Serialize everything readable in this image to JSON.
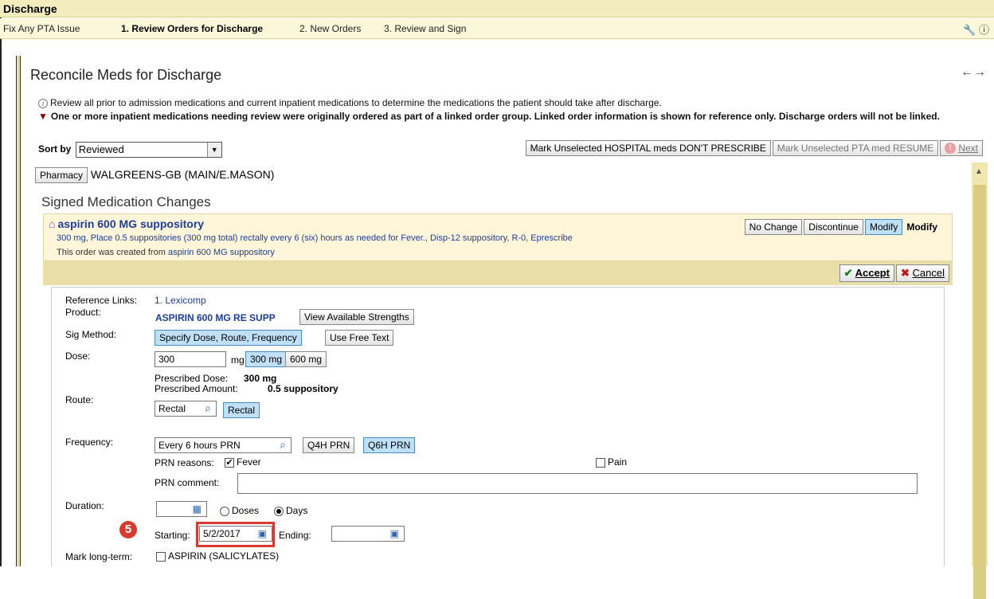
{
  "window": {
    "title": "Discharge"
  },
  "nav": {
    "items": [
      {
        "label": "Fix Any PTA Issue",
        "active": false
      },
      {
        "label": "1. Review Orders for Discharge",
        "active": true
      },
      {
        "label": "2. New Orders",
        "active": false
      },
      {
        "label": "3. Review and Sign",
        "active": false
      }
    ]
  },
  "section": {
    "title": "Reconcile Meds for Discharge"
  },
  "info": {
    "line1": "Review all prior to admission medications and current inpatient medications to determine the medications the patient should take after discharge.",
    "line2": "One or more inpatient medications needing review were originally ordered as part of a linked order group. Linked order information is shown for reference only. Discharge orders will not be linked."
  },
  "sort": {
    "label": "Sort by",
    "value": "Reviewed"
  },
  "actions": {
    "mark_hospital": "Mark Unselected HOSPITAL meds DON'T PRESCRIBE",
    "mark_pta": "Mark Unselected PTA med RESUME",
    "next": "Next"
  },
  "pharmacy": {
    "button": "Pharmacy",
    "name": "WALGREENS-GB (MAIN/E.MASON)"
  },
  "signed_changes": {
    "title": "Signed Medication Changes"
  },
  "med": {
    "name": "aspirin 600 MG suppository",
    "description": "300 mg, Place 0.5 suppositories (300 mg total) rectally every 6 (six) hours as needed for Fever., Disp-12 suppository, R-0, Eprescribe",
    "source_prefix": "This order was created from",
    "source_link": "aspirin 600 MG suppository",
    "buttons": {
      "no_change": "No Change",
      "discontinue": "Discontinue",
      "modify": "Modify"
    },
    "status": "Modify"
  },
  "edit": {
    "accept": "Accept",
    "cancel": "Cancel"
  },
  "order": {
    "ref_links_label": "Reference Links:",
    "ref_links_value": "1. Lexicomp",
    "product_label": "Product:",
    "product_value": "ASPIRIN 600 MG RE SUPP",
    "view_strengths": "View Available Strengths",
    "sig_label": "Sig Method:",
    "sig_specify": "Specify Dose, Route, Frequency",
    "sig_free": "Use Free Text",
    "dose_label": "Dose:",
    "dose_value": "300",
    "dose_unit": "mg",
    "dose_opt1": "300 mg",
    "dose_opt2": "600 mg",
    "prescribed_dose_label": "Prescribed Dose:",
    "prescribed_dose_value": "300 mg",
    "prescribed_amount_label": "Prescribed Amount:",
    "prescribed_amount_value": "0.5 suppository",
    "route_label": "Route:",
    "route_value": "Rectal",
    "route_btn": "Rectal",
    "freq_label": "Frequency:",
    "freq_value": "Every 6 hours PRN",
    "freq_opt1": "Q4H PRN",
    "freq_opt2": "Q6H PRN",
    "prn_reasons_label": "PRN reasons:",
    "prn_reason1": "Fever",
    "prn_reason2": "Pain",
    "prn_comment_label": "PRN comment:",
    "prn_comment_value": "",
    "duration_label": "Duration:",
    "duration_value": "",
    "doses_label": "Doses",
    "days_label": "Days",
    "starting_label": "Starting:",
    "starting_value": "5/2/2017",
    "ending_label": "Ending:",
    "ending_value": "",
    "long_term_label": "Mark long-term:",
    "long_term_option": "ASPIRIN (SALICYLATES)"
  },
  "callout": {
    "number": "5"
  },
  "colors": {
    "accent_red": "#d93a2f",
    "link_blue": "#1b3ea0",
    "selected_btn": "#bfe0f7",
    "gold": "#e9dea5"
  }
}
